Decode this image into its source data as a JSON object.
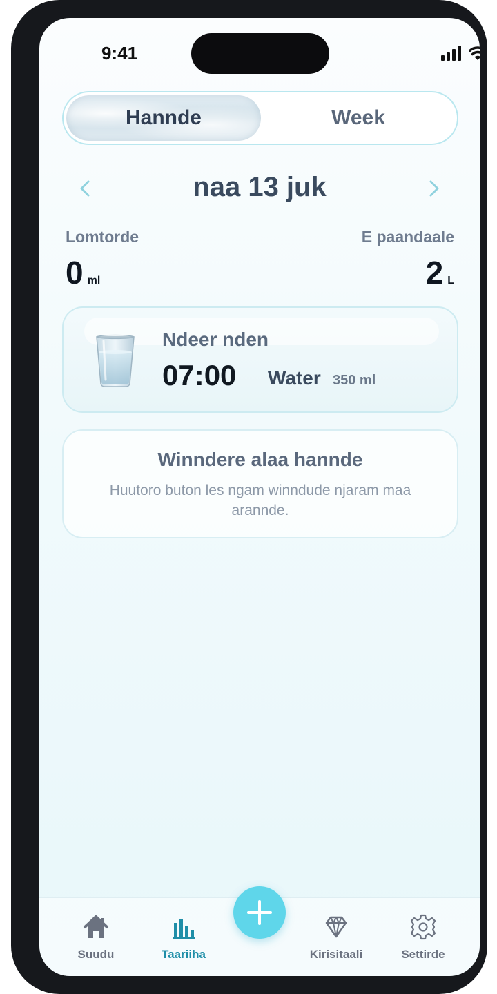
{
  "status": {
    "time": "9:41"
  },
  "segments": {
    "day": "Hannde",
    "week": "Week"
  },
  "date": {
    "title": "naa 13 juk"
  },
  "stats": {
    "consumed": {
      "label": "Lomtorde",
      "value": "0",
      "unit": "ml"
    },
    "goal": {
      "label": "E paandaale",
      "value": "2",
      "unit": "L"
    }
  },
  "entry": {
    "title": "Ndeer nden",
    "time": "07:00",
    "drink": "Water",
    "amount": "350 ml",
    "icon": "water-glass-icon"
  },
  "info": {
    "title": "Winndere alaa hannde",
    "text": "Huutoro buton les ngam winndude njaram maa arannde."
  },
  "tabs": [
    {
      "label": "Suudu",
      "icon": "home-icon"
    },
    {
      "label": "Taariiha",
      "icon": "bar-chart-icon",
      "active": true
    },
    {
      "label": "Kirisitaali",
      "icon": "diamond-icon"
    },
    {
      "label": "Settirde",
      "icon": "gear-icon"
    }
  ],
  "fab": {
    "icon": "plus-icon"
  },
  "colors": {
    "accent": "#5fd6ea",
    "active_tab": "#1f8ea8",
    "battery": "#36c759"
  }
}
